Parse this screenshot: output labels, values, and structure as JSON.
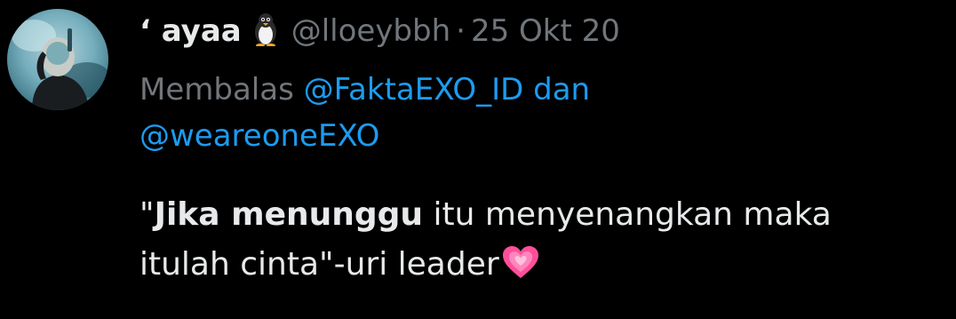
{
  "tweet": {
    "display_name": "ʻ ayaa",
    "handle": "@lloeybbh",
    "separator": "·",
    "date": "25 Okt 20",
    "reply": {
      "prefix": "Membalas",
      "mention1": "@FaktaEXO_ID",
      "conjunction": "dan",
      "mention2": "@weareoneEXO"
    },
    "text": {
      "open_quote": "\"",
      "bold": "Jika menunggu",
      "rest_line1": " itu menyenangkan maka",
      "line2": "itulah cinta\"-uri leader"
    },
    "icons": {
      "name_emoji": "penguin-icon",
      "text_emoji": "growing-heart-icon"
    }
  }
}
